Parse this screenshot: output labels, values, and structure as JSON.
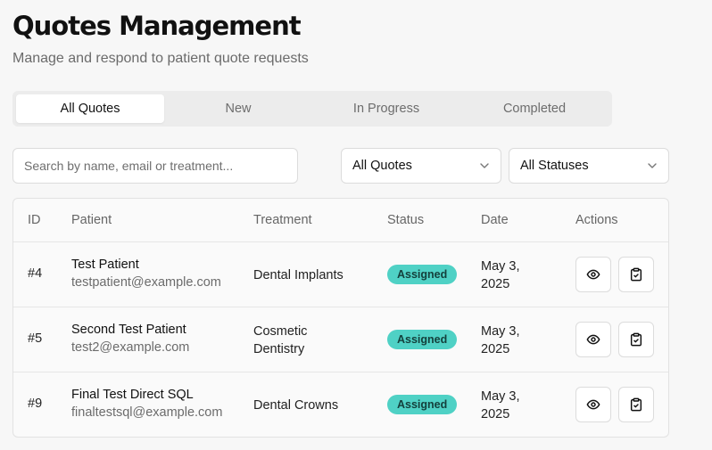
{
  "header": {
    "title": "Quotes Management",
    "subtitle": "Manage and respond to patient quote requests"
  },
  "tabs": [
    {
      "label": "All Quotes",
      "active": true
    },
    {
      "label": "New",
      "active": false
    },
    {
      "label": "In Progress",
      "active": false
    },
    {
      "label": "Completed",
      "active": false
    }
  ],
  "filters": {
    "search": {
      "placeholder": "Search by name, email or treatment...",
      "value": ""
    },
    "quote_filter": {
      "selected": "All Quotes"
    },
    "status_filter": {
      "selected": "All Statuses"
    }
  },
  "table": {
    "columns": [
      "ID",
      "Patient",
      "Treatment",
      "Status",
      "Date",
      "Actions"
    ],
    "rows": [
      {
        "id": "#4",
        "patient_name": "Test Patient",
        "patient_email": "testpatient@example.com",
        "treatment": "Dental Implants",
        "status": "Assigned",
        "date": "May 3, 2025"
      },
      {
        "id": "#5",
        "patient_name": "Second Test Patient",
        "patient_email": "test2@example.com",
        "treatment": "Cosmetic Dentistry",
        "status": "Assigned",
        "date": "May 3, 2025"
      },
      {
        "id": "#9",
        "patient_name": "Final Test Direct SQL",
        "patient_email": "finaltestsql@example.com",
        "treatment": "Dental Crowns",
        "status": "Assigned",
        "date": "May 3, 2025"
      }
    ]
  },
  "icons": {
    "view": "eye-icon",
    "clipboard": "clipboard-check-icon",
    "dropdown": "chevron-down-icon"
  },
  "colors": {
    "status_badge_bg": "#4fd1c5",
    "status_badge_text": "#14403c",
    "page_bg": "#f7f7f7"
  }
}
